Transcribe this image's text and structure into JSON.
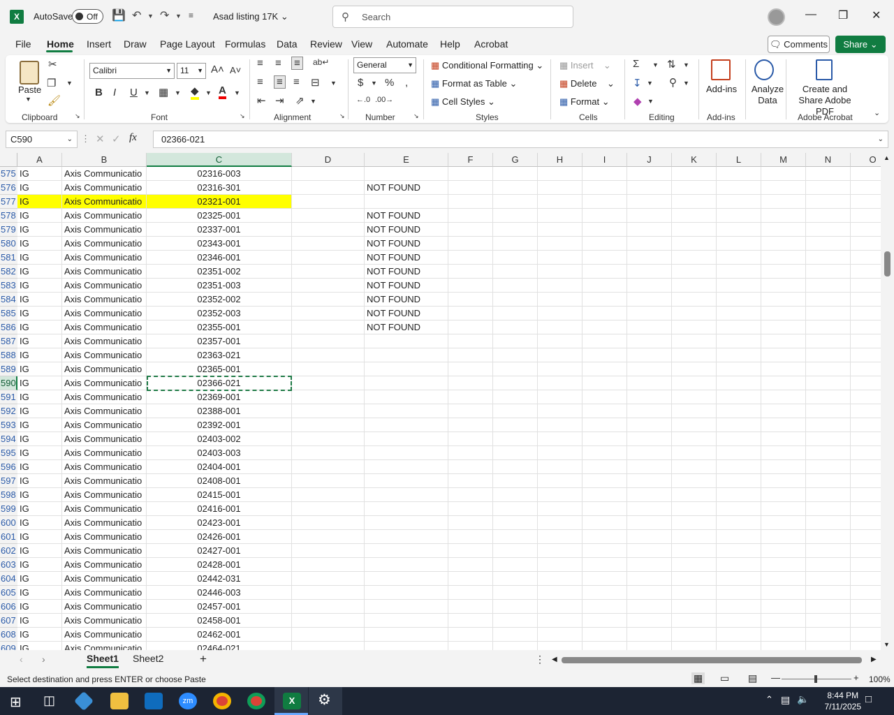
{
  "window": {
    "autosave_label": "AutoSave",
    "autosave_state": "Off",
    "doc_title": "Asad listing 17K",
    "search_placeholder": "Search"
  },
  "menu": {
    "tabs": [
      "File",
      "Home",
      "Insert",
      "Draw",
      "Page Layout",
      "Formulas",
      "Data",
      "Review",
      "View",
      "Automate",
      "Help",
      "Acrobat"
    ],
    "active_tab": "Home",
    "comments_label": "Comments",
    "share_label": "Share"
  },
  "ribbon": {
    "clipboard": {
      "paste": "Paste",
      "label": "Clipboard"
    },
    "font": {
      "name": "Calibri",
      "size": "11",
      "label": "Font"
    },
    "alignment": {
      "label": "Alignment"
    },
    "number": {
      "format": "General",
      "label": "Number"
    },
    "styles": {
      "conditional": "Conditional Formatting",
      "format_table": "Format as Table",
      "cell_styles": "Cell Styles",
      "label": "Styles"
    },
    "cells": {
      "insert": "Insert",
      "delete": "Delete",
      "format": "Format",
      "label": "Cells"
    },
    "editing": {
      "label": "Editing"
    },
    "addins": {
      "addins": "Add-ins",
      "analyze": "Analyze Data",
      "label": "Add-ins"
    },
    "acrobat": {
      "create": "Create and Share Adobe PDF",
      "label": "Adobe Acrobat"
    }
  },
  "formula_bar": {
    "name_box": "C590",
    "value": "02366-021"
  },
  "columns": [
    "A",
    "B",
    "C",
    "D",
    "E",
    "F",
    "G",
    "H",
    "I",
    "J",
    "K",
    "L",
    "M",
    "N",
    "O"
  ],
  "selected_column": "C",
  "selected_row": "590",
  "highlight_row": "577",
  "rows": [
    {
      "n": "575",
      "a": "IG",
      "b": "Axis Communicatio",
      "c": "02316-003",
      "e": ""
    },
    {
      "n": "576",
      "a": "IG",
      "b": "Axis Communicatio",
      "c": "02316-301",
      "e": "NOT FOUND"
    },
    {
      "n": "577",
      "a": "IG",
      "b": "Axis Communicatio",
      "c": "02321-001",
      "e": ""
    },
    {
      "n": "578",
      "a": "IG",
      "b": "Axis Communicatio",
      "c": "02325-001",
      "e": "NOT FOUND"
    },
    {
      "n": "579",
      "a": "IG",
      "b": "Axis Communicatio",
      "c": "02337-001",
      "e": "NOT FOUND"
    },
    {
      "n": "580",
      "a": "IG",
      "b": "Axis Communicatio",
      "c": "02343-001",
      "e": "NOT FOUND"
    },
    {
      "n": "581",
      "a": "IG",
      "b": "Axis Communicatio",
      "c": "02346-001",
      "e": "NOT FOUND"
    },
    {
      "n": "582",
      "a": "IG",
      "b": "Axis Communicatio",
      "c": "02351-002",
      "e": "NOT FOUND"
    },
    {
      "n": "583",
      "a": "IG",
      "b": "Axis Communicatio",
      "c": "02351-003",
      "e": "NOT FOUND"
    },
    {
      "n": "584",
      "a": "IG",
      "b": "Axis Communicatio",
      "c": "02352-002",
      "e": "NOT FOUND"
    },
    {
      "n": "585",
      "a": "IG",
      "b": "Axis Communicatio",
      "c": "02352-003",
      "e": "NOT FOUND"
    },
    {
      "n": "586",
      "a": "IG",
      "b": "Axis Communicatio",
      "c": "02355-001",
      "e": "NOT FOUND"
    },
    {
      "n": "587",
      "a": "IG",
      "b": "Axis Communicatio",
      "c": "02357-001",
      "e": ""
    },
    {
      "n": "588",
      "a": "IG",
      "b": "Axis Communicatio",
      "c": "02363-021",
      "e": ""
    },
    {
      "n": "589",
      "a": "IG",
      "b": "Axis Communicatio",
      "c": "02365-001",
      "e": ""
    },
    {
      "n": "590",
      "a": "IG",
      "b": "Axis Communicatio",
      "c": "02366-021",
      "e": ""
    },
    {
      "n": "591",
      "a": "IG",
      "b": "Axis Communicatio",
      "c": "02369-001",
      "e": ""
    },
    {
      "n": "592",
      "a": "IG",
      "b": "Axis Communicatio",
      "c": "02388-001",
      "e": ""
    },
    {
      "n": "593",
      "a": "IG",
      "b": "Axis Communicatio",
      "c": "02392-001",
      "e": ""
    },
    {
      "n": "594",
      "a": "IG",
      "b": "Axis Communicatio",
      "c": "02403-002",
      "e": ""
    },
    {
      "n": "595",
      "a": "IG",
      "b": "Axis Communicatio",
      "c": "02403-003",
      "e": ""
    },
    {
      "n": "596",
      "a": "IG",
      "b": "Axis Communicatio",
      "c": "02404-001",
      "e": ""
    },
    {
      "n": "597",
      "a": "IG",
      "b": "Axis Communicatio",
      "c": "02408-001",
      "e": ""
    },
    {
      "n": "598",
      "a": "IG",
      "b": "Axis Communicatio",
      "c": "02415-001",
      "e": ""
    },
    {
      "n": "599",
      "a": "IG",
      "b": "Axis Communicatio",
      "c": "02416-001",
      "e": ""
    },
    {
      "n": "600",
      "a": "IG",
      "b": "Axis Communicatio",
      "c": "02423-001",
      "e": ""
    },
    {
      "n": "601",
      "a": "IG",
      "b": "Axis Communicatio",
      "c": "02426-001",
      "e": ""
    },
    {
      "n": "602",
      "a": "IG",
      "b": "Axis Communicatio",
      "c": "02427-001",
      "e": ""
    },
    {
      "n": "603",
      "a": "IG",
      "b": "Axis Communicatio",
      "c": "02428-001",
      "e": ""
    },
    {
      "n": "604",
      "a": "IG",
      "b": "Axis Communicatio",
      "c": "02442-031",
      "e": ""
    },
    {
      "n": "605",
      "a": "IG",
      "b": "Axis Communicatio",
      "c": "02446-003",
      "e": ""
    },
    {
      "n": "606",
      "a": "IG",
      "b": "Axis Communicatio",
      "c": "02457-001",
      "e": ""
    },
    {
      "n": "607",
      "a": "IG",
      "b": "Axis Communicatio",
      "c": "02458-001",
      "e": ""
    },
    {
      "n": "608",
      "a": "IG",
      "b": "Axis Communicatio",
      "c": "02462-001",
      "e": ""
    },
    {
      "n": "609",
      "a": "IG",
      "b": "Axis Communicatio",
      "c": "02464-021",
      "e": ""
    }
  ],
  "sheets": [
    "Sheet1",
    "Sheet2"
  ],
  "active_sheet": "Sheet1",
  "status": {
    "message": "Select destination and press ENTER or choose Paste",
    "zoom": "100%"
  },
  "taskbar": {
    "time": "8:44 PM",
    "date": "7/11/2025"
  },
  "colors": {
    "accent": "#107c41",
    "highlight": "#ffff00",
    "taskbar": "#1c2433"
  }
}
